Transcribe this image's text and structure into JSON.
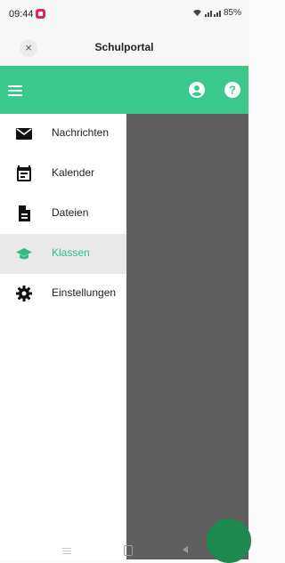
{
  "status_bar": {
    "time": "09:44",
    "battery": "85%"
  },
  "title_bar": {
    "close_symbol": "×",
    "title": "Schulportal"
  },
  "app_bar": {
    "color": "#3ac98b",
    "icons": [
      "menu-icon",
      "account-icon",
      "help-icon"
    ]
  },
  "drawer": {
    "items": [
      {
        "label": "Nachrichten",
        "icon": "mail-icon",
        "active": false
      },
      {
        "label": "Kalender",
        "icon": "calendar-icon",
        "active": false
      },
      {
        "label": "Dateien",
        "icon": "document-icon",
        "active": false
      },
      {
        "label": "Klassen",
        "icon": "graduation-cap-icon",
        "active": true
      },
      {
        "label": "Einstellungen",
        "icon": "gear-icon",
        "active": false
      }
    ],
    "active_color": "#2fbf84"
  }
}
